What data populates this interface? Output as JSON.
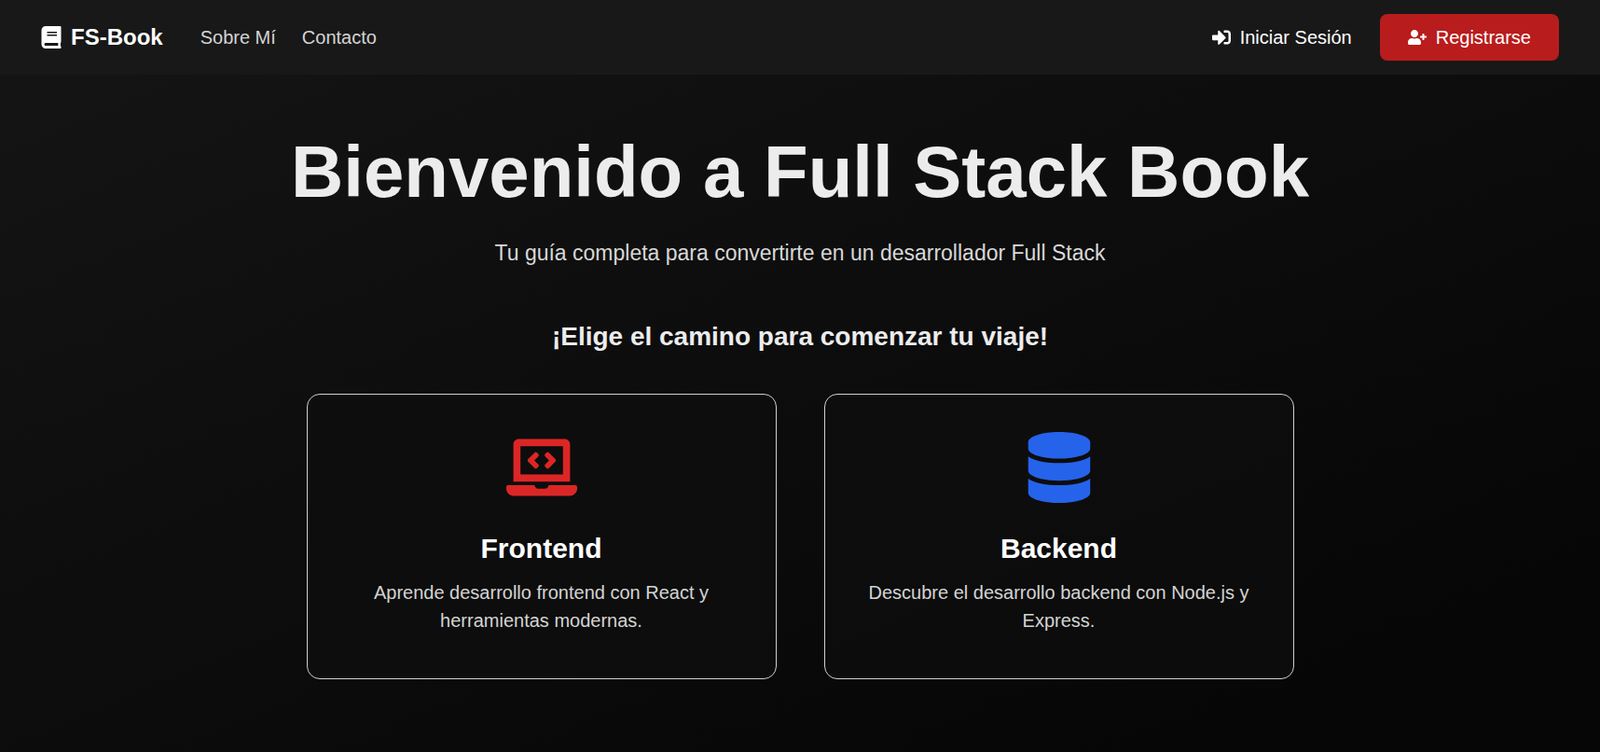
{
  "navbar": {
    "brand": "FS-Book",
    "links": [
      "Sobre Mí",
      "Contacto"
    ],
    "login": "Iniciar Sesión",
    "register": "Registrarse"
  },
  "hero": {
    "title": "Bienvenido a Full Stack Book",
    "subtitle": "Tu guía completa para convertirte en un desarrollador Full Stack",
    "prompt": "¡Elige el camino para comenzar tu viaje!"
  },
  "cards": [
    {
      "title": "Frontend",
      "description": "Aprende desarrollo frontend con React y herramientas modernas.",
      "color": "#dc2626"
    },
    {
      "title": "Backend",
      "description": "Descubre el desarrollo backend con Node.js y Express.",
      "color": "#2563eb"
    }
  ]
}
